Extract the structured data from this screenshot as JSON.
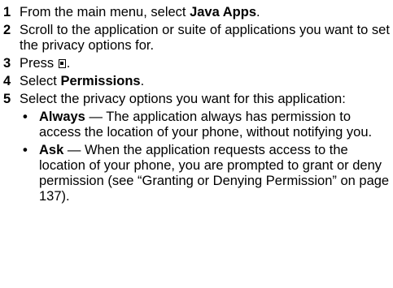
{
  "steps": [
    {
      "num": "1",
      "pre": "From the main menu, select ",
      "bold": "Java Apps",
      "post": "."
    },
    {
      "num": "2",
      "text": "Scroll to the application or suite of applications you want to set the privacy options for."
    },
    {
      "num": "3",
      "pre": "Press ",
      "icon": "menu-key-icon",
      "post": "."
    },
    {
      "num": "4",
      "pre": "Select ",
      "bold": "Permissions",
      "post": "."
    },
    {
      "num": "5",
      "text": "Select the privacy options you want for this application:"
    }
  ],
  "options": [
    {
      "bullet": "•",
      "bold": "Always",
      "text": " — The application always has permission to access the location of your phone, without notifying you."
    },
    {
      "bullet": "•",
      "bold": "Ask",
      "text": " — When the application requests access to the location of your phone, you are prompted to grant or deny permission (see “Granting or Denying Permission” on page 137)."
    }
  ]
}
